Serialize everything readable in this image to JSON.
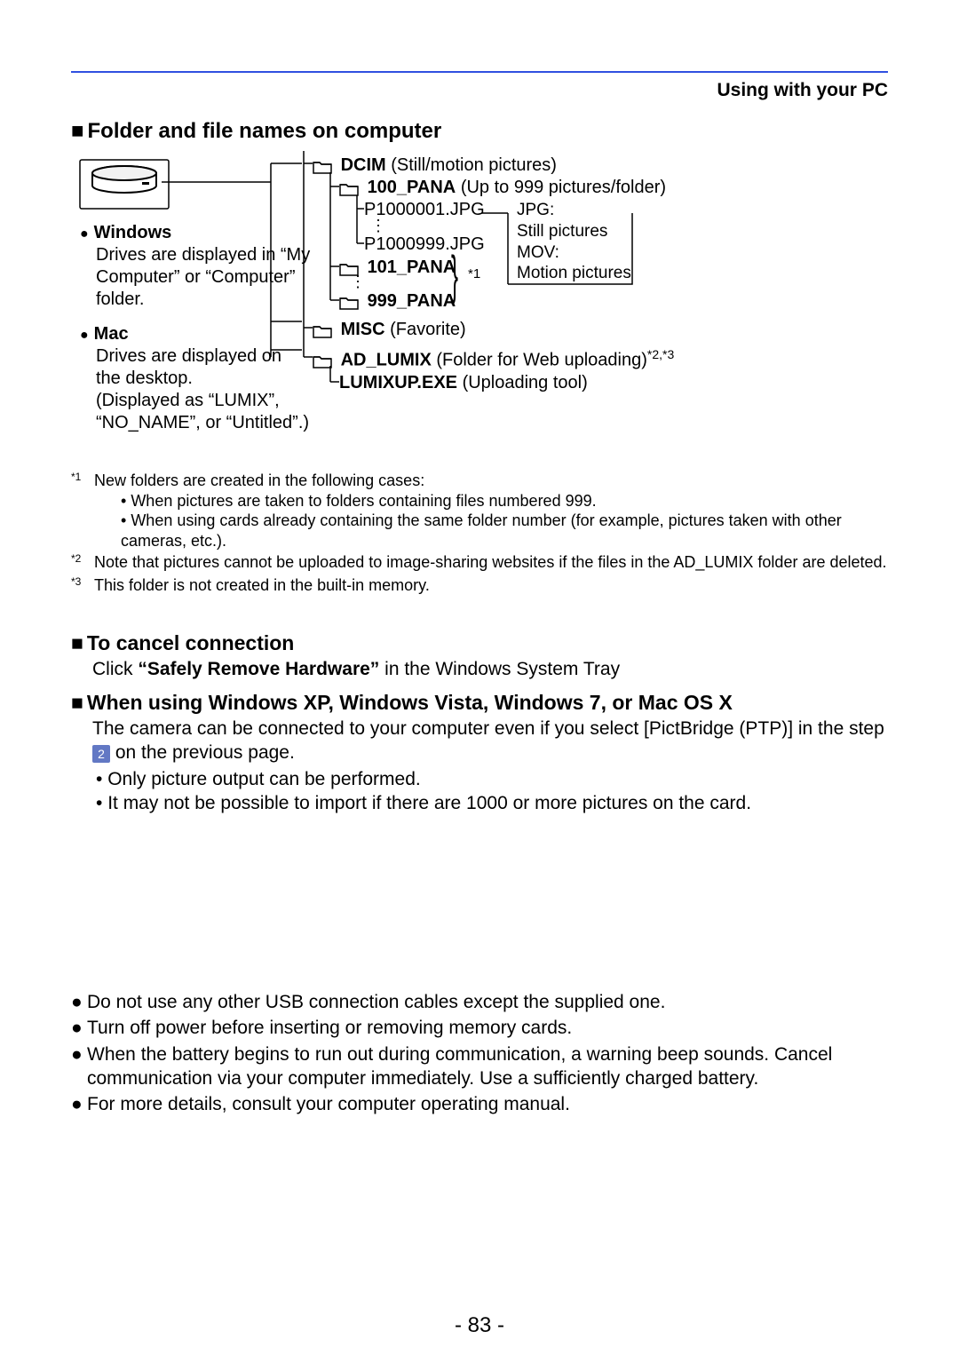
{
  "header": {
    "title": "Using with your PC"
  },
  "section1": {
    "title": "Folder and file names on computer"
  },
  "os": {
    "windows": {
      "name": "Windows",
      "desc": "Drives are displayed in “My Computer” or “Computer” folder."
    },
    "mac": {
      "name": "Mac",
      "desc": "Drives are displayed on the desktop.\n(Displayed as “LUMIX”, “NO_NAME”, or “Untitled”.)"
    }
  },
  "tree": {
    "dcim": {
      "name": "DCIM",
      "desc": "(Still/motion pictures)"
    },
    "f100": {
      "name": "100_PANA",
      "desc": "(Up to 999 pictures/folder)"
    },
    "file1": "P1000001.JPG",
    "file999": "P1000999.JPG",
    "f101": {
      "name": "101_PANA"
    },
    "f999": {
      "name": "999_PANA"
    },
    "misc": {
      "name": "MISC",
      "desc": "(Favorite)"
    },
    "adlumix": {
      "name": "AD_LUMIX",
      "desc": "(Folder for Web uploading)"
    },
    "adlumixSup": "*2,*3",
    "lumixup": {
      "name": "LUMIXUP.EXE",
      "desc": "(Uploading tool)"
    },
    "braceSup": "*1",
    "types": {
      "jpg": "JPG:",
      "jpgDesc": "Still pictures",
      "mov": "MOV:",
      "movDesc": "Motion pictures"
    }
  },
  "footnotes": {
    "n1mark": "*1",
    "n1": "New folders are created in the following cases:",
    "n1b1": "When pictures are taken to folders containing files numbered 999.",
    "n1b2": "When using cards already containing the same folder number (for example, pictures taken with other cameras, etc.).",
    "n2mark": "*2",
    "n2": "Note that pictures cannot be uploaded to image-sharing websites if the files in the AD_LUMIX folder are deleted.",
    "n3mark": "*3",
    "n3": "This folder is not created in the built-in memory."
  },
  "cancel": {
    "title": "To cancel connection",
    "body_pre": "Click ",
    "body_bold": "“Safely Remove Hardware”",
    "body_post": " in the Windows System Tray"
  },
  "winxp": {
    "title": "When using Windows XP, Windows Vista, Windows 7, or Mac OS X",
    "body1a": "The camera can be connected to your computer even if you select [PictBridge (PTP)] in the step ",
    "step": "2",
    "body1b": " on the previous page.",
    "b1": "Only picture output can be performed.",
    "b2": "It may not be possible to import if there are 1000 or more pictures on the card."
  },
  "bottom": {
    "b1": "Do not use any other USB connection cables except the supplied one.",
    "b2": "Turn off power before inserting or removing memory cards.",
    "b3": "When the battery begins to run out during communication, a warning beep sounds. Cancel communication via your computer immediately. Use a sufficiently charged battery.",
    "b4": "For more details, consult your computer operating manual."
  },
  "pageNumber": "- 83 -"
}
